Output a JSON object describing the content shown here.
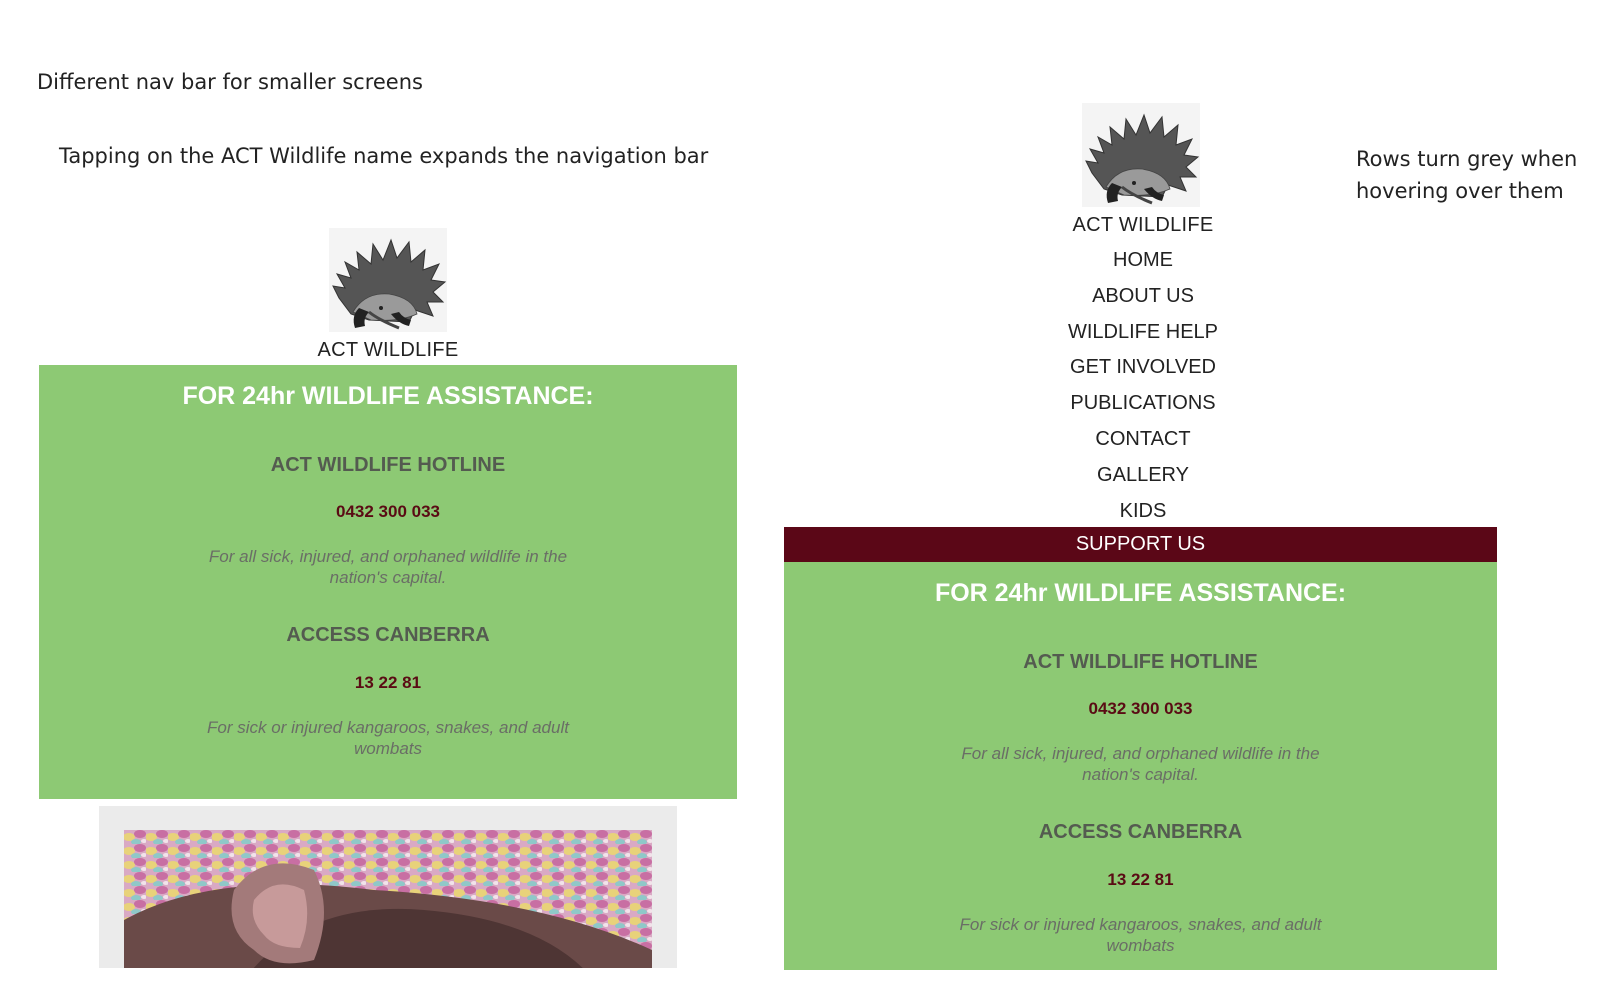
{
  "notes": {
    "nav_note": "Different nav bar for smaller screens",
    "tap_note": "Tapping on the ACT Wildlife name expands the navigation bar",
    "hover_note": "Rows turn grey when hovering over them"
  },
  "brand": "ACT WILDLIFE",
  "nav": {
    "items": [
      "HOME",
      "ABOUT US",
      "WILDLIFE HELP",
      "GET INVOLVED",
      "PUBLICATIONS",
      "CONTACT",
      "GALLERY",
      "KIDS"
    ],
    "support": "SUPPORT US"
  },
  "assistance": {
    "title": "FOR 24hr WILDLIFE ASSISTANCE:",
    "hotline_name": "ACT WILDLIFE HOTLINE",
    "hotline_phone": "0432 300 033",
    "hotline_desc": "For all sick, injured, and orphaned wildlife in the nation's capital.",
    "access_name": "ACCESS CANBERRA",
    "access_phone": "13 22 81",
    "access_desc": "For sick or injured kangaroos, snakes, and adult wombats"
  },
  "colors": {
    "panel_green": "#8dc974",
    "support_maroon": "#5b0717",
    "phone_red": "#5a0b14"
  },
  "icons": {
    "logo": "echidna-logo-icon",
    "photo": "baby-wombat-in-knitted-pouch-image"
  }
}
